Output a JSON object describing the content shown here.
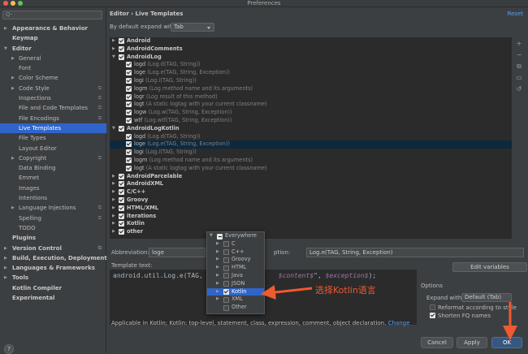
{
  "window": {
    "title": "Preferences"
  },
  "colors": {
    "accent": "#2f65ca",
    "annotation": "#ef5a31",
    "link": "#589df6"
  },
  "sidebar": {
    "search_placeholder": "Q-",
    "items": [
      {
        "label": "Appearance & Behavior",
        "level": 0,
        "arrow": "▶",
        "bold": true
      },
      {
        "label": "Keymap",
        "level": 0,
        "arrow": "",
        "bold": true
      },
      {
        "label": "Editor",
        "level": 0,
        "arrow": "▼",
        "bold": true
      },
      {
        "label": "General",
        "level": 1,
        "arrow": "▶"
      },
      {
        "label": "Font",
        "level": 1,
        "arrow": ""
      },
      {
        "label": "Color Scheme",
        "level": 1,
        "arrow": "▶"
      },
      {
        "label": "Code Style",
        "level": 1,
        "arrow": "▶",
        "copy": true
      },
      {
        "label": "Inspections",
        "level": 1,
        "arrow": "",
        "copy": true
      },
      {
        "label": "File and Code Templates",
        "level": 1,
        "arrow": "",
        "copy": true
      },
      {
        "label": "File Encodings",
        "level": 1,
        "arrow": "",
        "copy": true
      },
      {
        "label": "Live Templates",
        "level": 1,
        "arrow": "",
        "selected": true
      },
      {
        "label": "File Types",
        "level": 1,
        "arrow": ""
      },
      {
        "label": "Layout Editor",
        "level": 1,
        "arrow": ""
      },
      {
        "label": "Copyright",
        "level": 1,
        "arrow": "▶",
        "copy": true
      },
      {
        "label": "Data Binding",
        "level": 1,
        "arrow": ""
      },
      {
        "label": "Emmet",
        "level": 1,
        "arrow": ""
      },
      {
        "label": "Images",
        "level": 1,
        "arrow": ""
      },
      {
        "label": "Intentions",
        "level": 1,
        "arrow": ""
      },
      {
        "label": "Language Injections",
        "level": 1,
        "arrow": "▶",
        "copy": true
      },
      {
        "label": "Spelling",
        "level": 1,
        "arrow": "",
        "copy": true
      },
      {
        "label": "TODO",
        "level": 1,
        "arrow": ""
      },
      {
        "label": "Plugins",
        "level": 0,
        "arrow": "",
        "bold": true
      },
      {
        "label": "Version Control",
        "level": 0,
        "arrow": "▶",
        "bold": true,
        "copy": true
      },
      {
        "label": "Build, Execution, Deployment",
        "level": 0,
        "arrow": "▶",
        "bold": true
      },
      {
        "label": "Languages & Frameworks",
        "level": 0,
        "arrow": "▶",
        "bold": true
      },
      {
        "label": "Tools",
        "level": 0,
        "arrow": "▶",
        "bold": true
      },
      {
        "label": "Kotlin Compiler",
        "level": 0,
        "arrow": "",
        "bold": true
      },
      {
        "label": "Experimental",
        "level": 0,
        "arrow": "",
        "bold": true
      }
    ]
  },
  "header": {
    "breadcrumb": "Editor  ›  Live Templates",
    "reset": "Reset"
  },
  "expand": {
    "label": "By default expand with",
    "value": "Tab"
  },
  "templates": [
    {
      "name": "Android",
      "group": true,
      "arrow": "▶"
    },
    {
      "name": "AndroidComments",
      "group": true,
      "arrow": "▶"
    },
    {
      "name": "AndroidLog",
      "group": true,
      "arrow": "▼"
    },
    {
      "name": "logd",
      "desc": "(Log.d(TAG, String))"
    },
    {
      "name": "loge",
      "desc": "(Log.e(TAG, String, Exception))"
    },
    {
      "name": "logi",
      "desc": "(Log.i(TAG, String))"
    },
    {
      "name": "logm",
      "desc": "(Log method name and its arguments)"
    },
    {
      "name": "logr",
      "desc": "(Log result of this method)"
    },
    {
      "name": "logt",
      "desc": "(A static logtag with your current classname)"
    },
    {
      "name": "logw",
      "desc": "(Log.w(TAG, String, Exception))"
    },
    {
      "name": "wtf",
      "desc": "(Log.wtf(TAG, String, Exception))"
    },
    {
      "name": "AndroidLogKotlin",
      "group": true,
      "arrow": "▼"
    },
    {
      "name": "logd",
      "desc": "(Log.d(TAG, String))"
    },
    {
      "name": "loge",
      "desc": "(Log.e(TAG, String, Exception))",
      "highlight": true
    },
    {
      "name": "logi",
      "desc": "(Log.i(TAG, String))"
    },
    {
      "name": "logm",
      "desc": "(Log method name and its arguments)"
    },
    {
      "name": "logt",
      "desc": "(A static logtag with your current classname)"
    },
    {
      "name": "AndroidParcelable",
      "group": true,
      "arrow": "▶"
    },
    {
      "name": "AndroidXML",
      "group": true,
      "arrow": "▶"
    },
    {
      "name": "C/C++",
      "group": true,
      "arrow": "▶"
    },
    {
      "name": "Groovy",
      "group": true,
      "arrow": "▶"
    },
    {
      "name": "HTML/XML",
      "group": true,
      "arrow": "▶"
    },
    {
      "name": "iterations",
      "group": true,
      "arrow": "▶"
    },
    {
      "name": "Kotlin",
      "group": true,
      "arrow": "▶"
    },
    {
      "name": "other",
      "group": true,
      "arrow": "▶"
    }
  ],
  "toolbar": {
    "add": "+",
    "remove": "−",
    "copy": "⧉",
    "restore": "▭",
    "undo": "↺"
  },
  "fields": {
    "abbreviation_label": "Abbreviation:",
    "abbreviation_value": "loge",
    "description_label": "ption:",
    "description_value": "Log.e(TAG, String, Exception)",
    "template_text_label": "Template text:",
    "code_a": "android.util.Log.e(TAG,",
    "code_b": "$content$",
    "code_c": "\", ",
    "code_d": "$exception$",
    "code_e": ");",
    "edit_variables": "Edit variables"
  },
  "options": {
    "title": "Options",
    "expand_label": "Expand with",
    "expand_value": "Default (Tab)",
    "reformat": "Reformat according to style",
    "reformat_checked": false,
    "shorten": "Shorten FQ names",
    "shorten_checked": true
  },
  "applicable": {
    "text": "Applicable in Kotlin; Kotlin: top-level, statement, class, expression, comment, object declaration.",
    "change": "Change"
  },
  "popup": {
    "items": [
      {
        "label": "Everywhere",
        "arrow": "▼",
        "level": 0,
        "state": "part"
      },
      {
        "label": "C",
        "arrow": "▶",
        "level": 1,
        "state": "off"
      },
      {
        "label": "C++",
        "arrow": "▶",
        "level": 1,
        "state": "off"
      },
      {
        "label": "Groovy",
        "arrow": "▶",
        "level": 1,
        "state": "off"
      },
      {
        "label": "HTML",
        "arrow": "▶",
        "level": 1,
        "state": "off"
      },
      {
        "label": "Java",
        "arrow": "▶",
        "level": 1,
        "state": "off"
      },
      {
        "label": "JSON",
        "arrow": "▶",
        "level": 1,
        "state": "off"
      },
      {
        "label": "Kotlin",
        "arrow": "▶",
        "level": 1,
        "state": "on",
        "selected": true
      },
      {
        "label": "XML",
        "arrow": "▶",
        "level": 1,
        "state": "off"
      },
      {
        "label": "Other",
        "arrow": "",
        "level": 1,
        "state": "off"
      }
    ]
  },
  "annotation": {
    "text": "选择Kotlin语言"
  },
  "buttons": {
    "cancel": "Cancel",
    "apply": "Apply",
    "ok": "OK",
    "help": "?"
  }
}
